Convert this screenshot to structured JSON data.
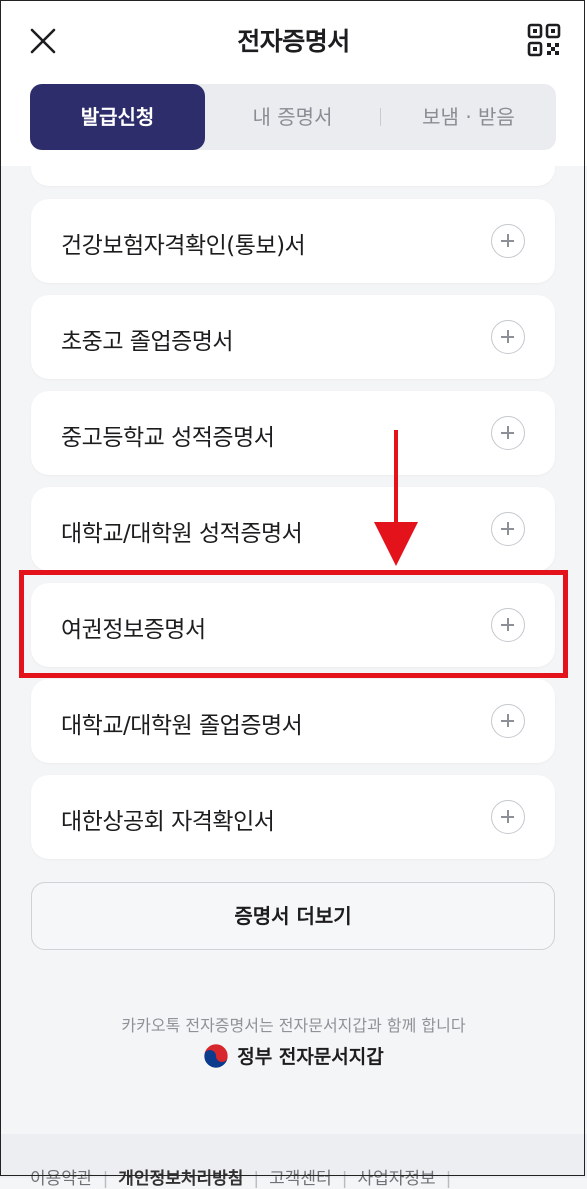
{
  "header": {
    "title": "전자증명서",
    "close_icon": "close-icon",
    "qr_icon": "qr-code-icon"
  },
  "tabs": [
    {
      "label": "발급신청",
      "active": true
    },
    {
      "label": "내 증명서",
      "active": false
    },
    {
      "label": "보냄 · 받음",
      "active": false
    }
  ],
  "certificates": [
    {
      "label": "건강보험자격확인(통보)서"
    },
    {
      "label": "초중고 졸업증명서"
    },
    {
      "label": "중고등학교 성적증명서"
    },
    {
      "label": "대학교/대학원 성적증명서"
    },
    {
      "label": "여권정보증명서"
    },
    {
      "label": "대학교/대학원 졸업증명서"
    },
    {
      "label": "대한상공회 자격확인서"
    }
  ],
  "more_button": "증명서 더보기",
  "footer": {
    "note": "카카오톡 전자증명서는 전자문서지갑과 함께 합니다",
    "gov_label": "정부 전자문서지갑"
  },
  "bottom_links": [
    "이용약관",
    "개인정보처리방침",
    "고객센터",
    "사업자정보"
  ],
  "colors": {
    "accent": "#2e2d6b",
    "highlight": "#e3121b"
  }
}
